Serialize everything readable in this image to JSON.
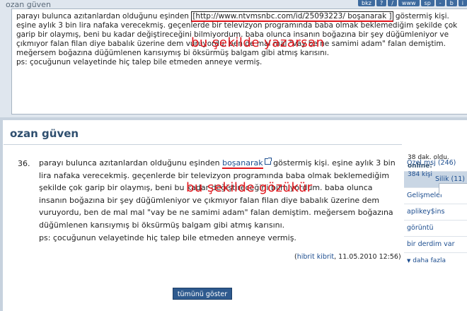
{
  "editor": {
    "title": "ozan güven",
    "toolbar": [
      "bkz",
      "?",
      "/",
      "www",
      "sp",
      "-",
      "b",
      "i"
    ],
    "text_pre": "parayı bulunca azıtanlardan olduğunu eşinden ",
    "url_text": "[http://www.ntvmsnbc.com/id/25093223/ boşanarak ]",
    "text_post_line1": " göstermiş kişi. eşine aylık 3 bin lira nafaka verecekmiş. geçenlerde bir televizyon programında baba olmak beklemediğim şekilde çok garip bir olaymış, beni bu kadar değiştireceğini bilmiyordum. baba olunca insanın boğazına bir şey düğümleniyor ve çıkmıyor falan filan diye babalık üzerine dem vuruyordu, ben de mal mal \"vay be ne samimi adam\" falan demiştim. meğersem boğazına düğümlenen karısıymış bi öksürmüş balgam gibi atmış karısını.",
    "text_ps": "ps: çocuğunun velayetinde hiç talep bile etmeden anneye vermiş."
  },
  "page": {
    "title": "ozan güven"
  },
  "entry": {
    "number": "36.",
    "text_pre": "parayı bulunca azıtanlardan olduğunu eşinden ",
    "link_text": "boşanarak",
    "text_post": " göstermiş kişi. eşine aylık 3 bin lira nafaka verecekmiş. geçenlerde bir televizyon programında baba olmak beklemediğim şekilde çok garip bir olaymış, beni bu kadar değiştireceğini bilmiyordum. baba olunca insanın boğazına bir şey düğümleniyor ve çıkmıyor falan filan diye babalık üzerine dem vuruyordu, ben de mal mal \"vay be ne samimi adam\" falan demiştim. meğersem boğazına düğümlenen karısıymış bi öksürmüş balgam gibi atmış karısını.",
    "ps": "ps: çocuğunun velayetinde hiç talep bile etmeden anneye vermiş.",
    "meta_open": "(",
    "author": "hibrit kibrit",
    "meta_date": ", 11.05.2010 12:56)"
  },
  "show_all_label": "tümünü göster",
  "sidebar": {
    "items": [
      {
        "label": "Özel msj (246)"
      },
      {
        "label": "Silik (11)"
      },
      {
        "label": "Gelişmeler"
      },
      {
        "label": "aplikey$ins"
      },
      {
        "label": "görüntü"
      },
      {
        "label": "bir derdim var"
      }
    ],
    "more_label": "daha fazla",
    "status_time": "38 dak. oldu.",
    "status_online_label": "online:",
    "status_online_count": "384 kişi"
  },
  "annotations": {
    "top": "bu şekilde yazarsan",
    "bottom": "bu şekilde gözükür"
  },
  "colors": {
    "accent": "#2e5a8e",
    "link": "#1c4d8f",
    "annotation": "#e0161c"
  }
}
